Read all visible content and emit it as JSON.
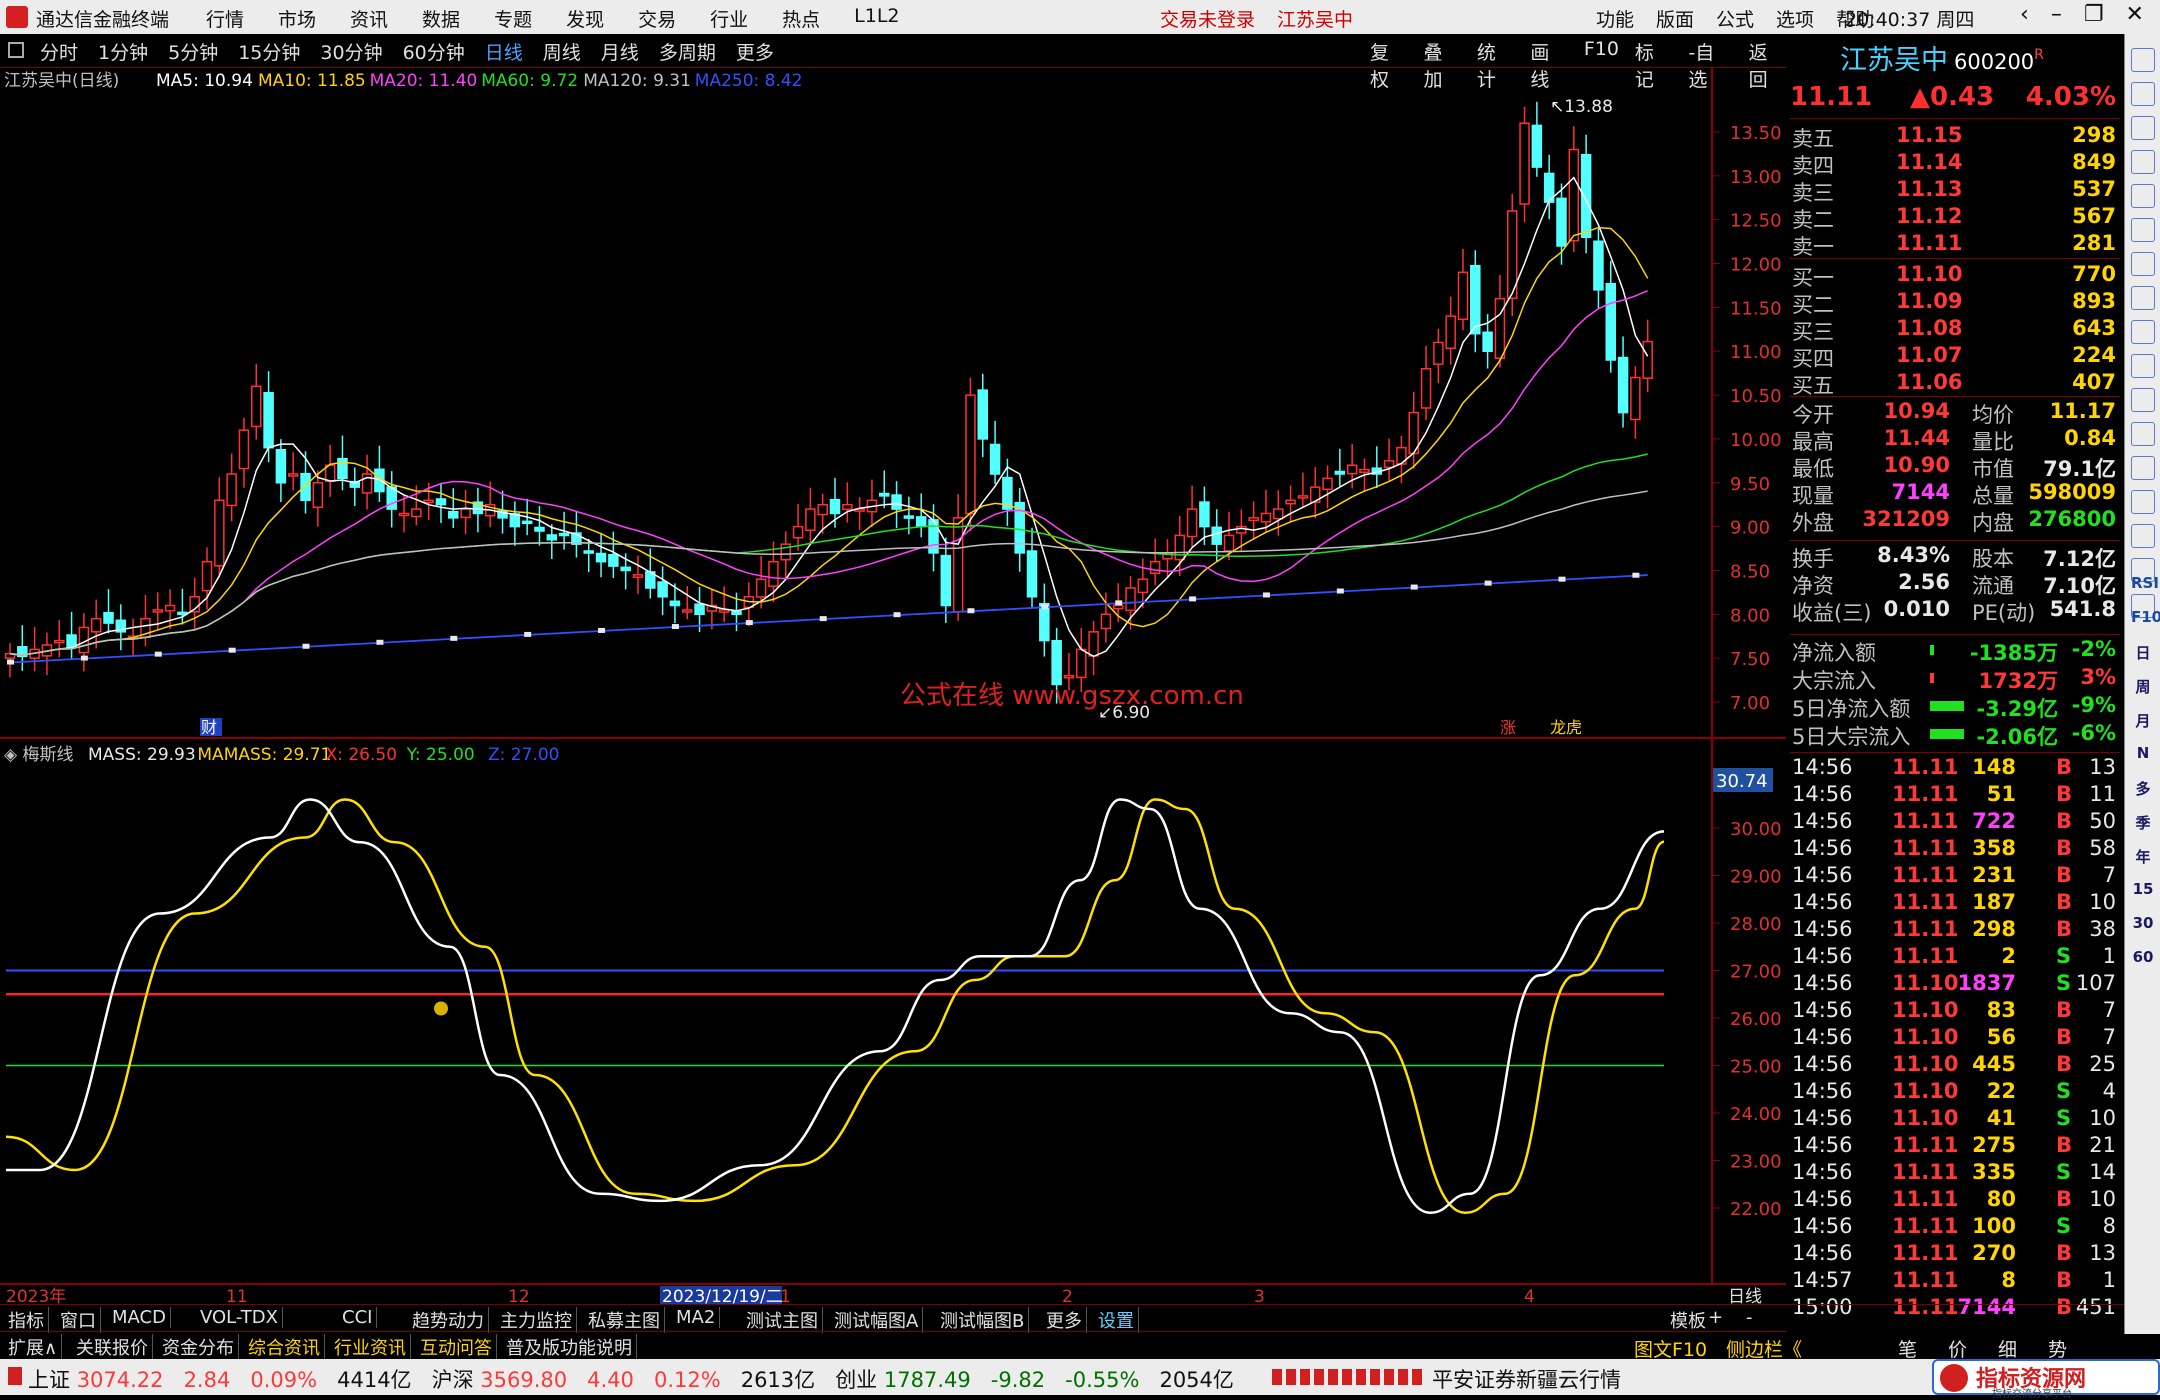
{
  "title": {
    "app": "通达信金融终端",
    "menus": [
      "行情",
      "市场",
      "资讯",
      "数据",
      "专题",
      "发现",
      "交易",
      "行业",
      "热点",
      "L1L2"
    ],
    "trade_status": "交易未登录",
    "stock_title": "江苏吴中",
    "right_menus": [
      "功能",
      "版面",
      "公式",
      "选项",
      "帮助"
    ],
    "time": "20:40:37",
    "weekday": "周四"
  },
  "toolbar": {
    "periods": [
      "分时",
      "1分钟",
      "5分钟",
      "15分钟",
      "30分钟",
      "60分钟",
      "日线",
      "周线",
      "月线",
      "多周期",
      "更多"
    ],
    "active": "日线",
    "right": [
      "复权",
      "叠加",
      "统计",
      "画线",
      "F10",
      "标记",
      "-自选",
      "返回"
    ]
  },
  "main_legend": {
    "name": "江苏吴中(日线)",
    "ma": [
      {
        "t": "MA5: 10.94",
        "c": "#ffffff"
      },
      {
        "t": "MA10: 11.85",
        "c": "#ffd400"
      },
      {
        "t": "MA20: 11.40",
        "c": "#ff40ff"
      },
      {
        "t": "MA60: 9.72",
        "c": "#20e020"
      },
      {
        "t": "MA120: 9.31",
        "c": "#c0c0c0"
      },
      {
        "t": "MA250: 8.42",
        "c": "#3050ff"
      }
    ]
  },
  "mass_legend": {
    "name": "梅斯线",
    "items": [
      {
        "t": "MASS: 29.93",
        "c": "#e8e8e8"
      },
      {
        "t": "MAMASS: 29.71",
        "c": "#ffd400"
      },
      {
        "t": "X: 26.50",
        "c": "#ff3030"
      },
      {
        "t": "Y: 25.00",
        "c": "#20e020"
      },
      {
        "t": "Z: 27.00",
        "c": "#3050ff"
      }
    ]
  },
  "price_axis": [
    "13.50",
    "13.00",
    "12.50",
    "12.00",
    "11.50",
    "11.00",
    "10.50",
    "10.00",
    "9.50",
    "9.00",
    "8.50",
    "8.00",
    "7.50",
    "7.00"
  ],
  "mass_axis": [
    "30.00",
    "29.00",
    "28.00",
    "27.00",
    "26.00",
    "25.00",
    "24.00",
    "23.00",
    "22.00"
  ],
  "mass_current": "30.74",
  "annotations": {
    "high": "13.88",
    "low": "6.90",
    "watermark": "公式在线 www.gszx.com.cn",
    "cai": "财",
    "zhang": "涨",
    "longhu": "龙虎"
  },
  "x_axis": {
    "year": "2023年",
    "m11": "11",
    "m12": "12",
    "cursor": "2023/12/19/二",
    "m1": "1",
    "m2": "2",
    "m3": "3",
    "m4": "4",
    "period": "日线"
  },
  "chart_data": {
    "type": "line",
    "title": "江苏吴中(日线)",
    "series": [
      {
        "name": "MASS",
        "last": 29.93
      },
      {
        "name": "MAMASS",
        "last": 29.71
      }
    ],
    "levels": {
      "X": 26.5,
      "Y": 25.0,
      "Z": 27.0
    },
    "ylim": [
      21.5,
      31.0
    ],
    "price_ylim": [
      6.9,
      13.88
    ]
  },
  "stock": {
    "name": "江苏吴中",
    "code": "600200",
    "r": "R",
    "price": "11.11",
    "change": "▲0.43",
    "pct": "4.03%"
  },
  "asks": [
    [
      "卖五",
      "11.15",
      "298"
    ],
    [
      "卖四",
      "11.14",
      "849"
    ],
    [
      "卖三",
      "11.13",
      "537"
    ],
    [
      "卖二",
      "11.12",
      "567"
    ],
    [
      "卖一",
      "11.11",
      "281"
    ]
  ],
  "bids": [
    [
      "买一",
      "11.10",
      "770"
    ],
    [
      "买二",
      "11.09",
      "893"
    ],
    [
      "买三",
      "11.08",
      "643"
    ],
    [
      "买四",
      "11.07",
      "224"
    ],
    [
      "买五",
      "11.06",
      "407"
    ]
  ],
  "stats": [
    [
      "今开",
      "10.94",
      "均价",
      "11.17"
    ],
    [
      "最高",
      "11.44",
      "量比",
      "0.84"
    ],
    [
      "最低",
      "10.90",
      "市值",
      "79.1亿"
    ],
    [
      "现量",
      "7144",
      "总量",
      "598009"
    ],
    [
      "外盘",
      "321209",
      "内盘",
      "276800"
    ]
  ],
  "stats2": [
    [
      "换手",
      "8.43%",
      "股本",
      "7.12亿"
    ],
    [
      "净资",
      "2.56",
      "流通",
      "7.10亿"
    ],
    [
      "收益(三)",
      "0.010",
      "PE(动)",
      "541.8"
    ]
  ],
  "flows": [
    [
      "净流入额",
      "-1385万",
      "-2%"
    ],
    [
      "大宗流入",
      "1732万",
      "3%"
    ],
    [
      "5日净流入额",
      "-3.29亿",
      "-9%"
    ],
    [
      "5日大宗流入",
      "-2.06亿",
      "-6%"
    ]
  ],
  "ticks": [
    [
      "14:56",
      "11.11",
      "148",
      "B",
      "13"
    ],
    [
      "14:56",
      "11.11",
      "51",
      "B",
      "11"
    ],
    [
      "14:56",
      "11.11",
      "722",
      "B",
      "50"
    ],
    [
      "14:56",
      "11.11",
      "358",
      "B",
      "58"
    ],
    [
      "14:56",
      "11.11",
      "231",
      "B",
      "7"
    ],
    [
      "14:56",
      "11.11",
      "187",
      "B",
      "10"
    ],
    [
      "14:56",
      "11.11",
      "298",
      "B",
      "38"
    ],
    [
      "14:56",
      "11.11",
      "2",
      "S",
      "1"
    ],
    [
      "14:56",
      "11.10",
      "1837",
      "S",
      "107"
    ],
    [
      "14:56",
      "11.10",
      "83",
      "B",
      "7"
    ],
    [
      "14:56",
      "11.10",
      "56",
      "B",
      "7"
    ],
    [
      "14:56",
      "11.10",
      "445",
      "B",
      "25"
    ],
    [
      "14:56",
      "11.10",
      "22",
      "S",
      "4"
    ],
    [
      "14:56",
      "11.10",
      "41",
      "S",
      "10"
    ],
    [
      "14:56",
      "11.11",
      "275",
      "B",
      "21"
    ],
    [
      "14:56",
      "11.11",
      "335",
      "S",
      "14"
    ],
    [
      "14:56",
      "11.11",
      "80",
      "B",
      "10"
    ],
    [
      "14:56",
      "11.11",
      "100",
      "S",
      "8"
    ],
    [
      "14:56",
      "11.11",
      "270",
      "B",
      "13"
    ],
    [
      "14:57",
      "11.11",
      "8",
      "B",
      "1"
    ],
    [
      "15:00",
      "11.11",
      "7144",
      "B",
      "451"
    ]
  ],
  "tabs": [
    "指标",
    "窗口",
    "MACD",
    "VOL-TDX",
    "CCI",
    "趋势动力",
    "主力监控",
    "私募主图",
    "MA2",
    "测试主图",
    "测试幅图A",
    "测试幅图B",
    "更多",
    "设置"
  ],
  "tabs_right": [
    "模板",
    "+",
    "-"
  ],
  "tabs2": [
    "扩展∧",
    "关联报价",
    "资金分布",
    "综合资讯",
    "行业资讯",
    "互动问答",
    "普及版功能说明"
  ],
  "tabs2_right": [
    "图文F10",
    "侧边栏《",
    "笔",
    "价",
    "细",
    "势"
  ],
  "status": {
    "sh_name": "上证",
    "sh": "3074.22",
    "sh_chg": "2.84",
    "sh_pct": "0.09%",
    "sh_amt": "4414亿",
    "sz_name": "沪深",
    "sz": "3569.80",
    "sz_chg": "4.40",
    "sz_pct": "0.12%",
    "sz_amt": "2613亿",
    "cy_name": "创业",
    "cy": "1787.49",
    "cy_chg": "-9.82",
    "cy_pct": "-0.55%",
    "cy_amt": "2054亿",
    "broker": "平安证券新疆云行情",
    "badge": "指标资源网",
    "badge_sub": "指标交流分享平台"
  },
  "sidebar": [
    "RSI",
    "F10",
    "日",
    "周",
    "月",
    "N",
    "多",
    "季",
    "年",
    "15",
    "30",
    "60"
  ]
}
